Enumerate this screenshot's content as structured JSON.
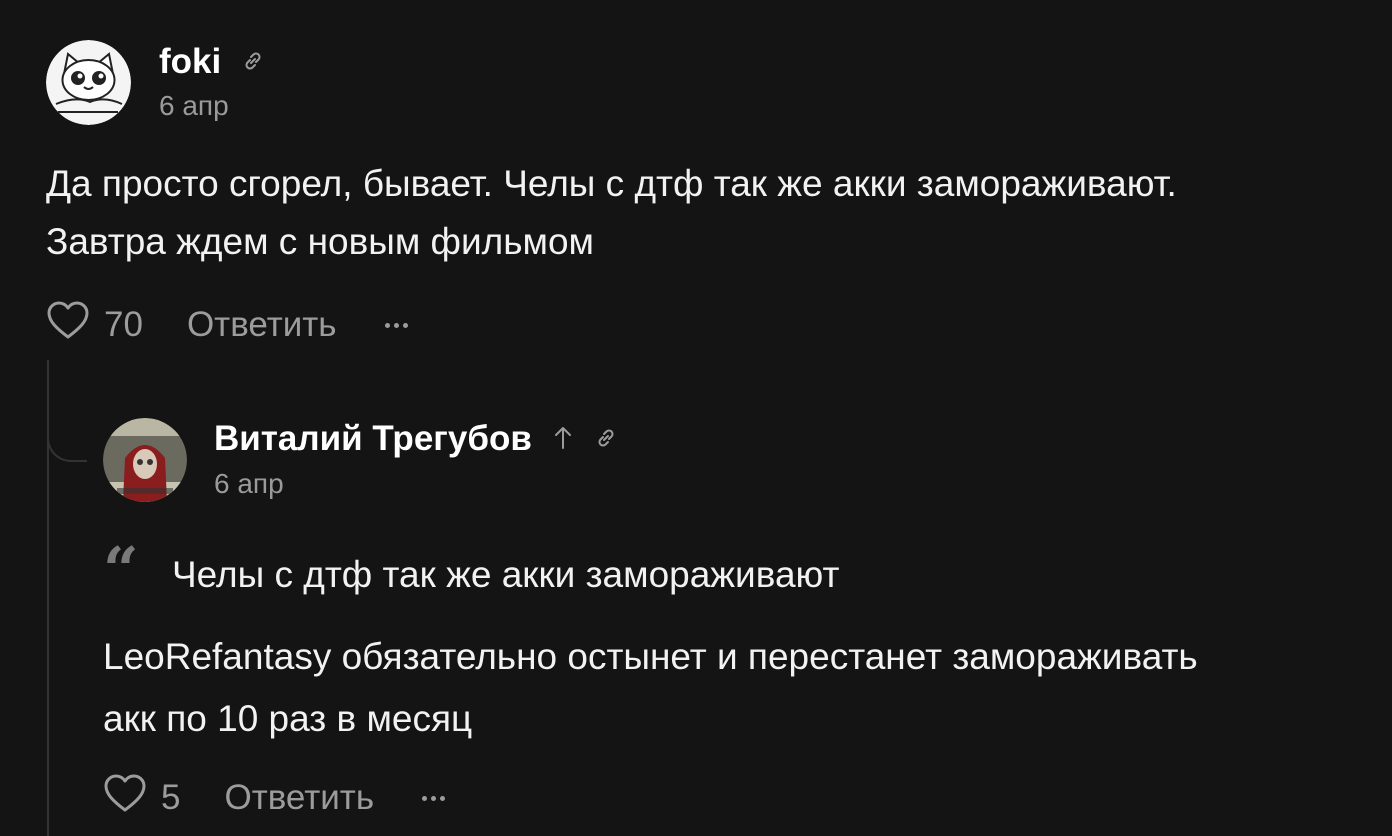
{
  "comment": {
    "author": "foki",
    "date": "6 апр",
    "text_line1": "Да просто сгорел, бывает. Челы с дтф так же акки замораживают.",
    "text_line2": "Завтра ждем с новым фильмом",
    "likes": "70",
    "reply_label": "Ответить",
    "avatar_icon": "cat-avatar",
    "link_icon": "link-icon"
  },
  "reply": {
    "author": "Виталий Трегубов",
    "date": "6 апр",
    "quote": "Челы с дтф так же акки замораживают",
    "text_line1": "LeoRefantasy обязательно остынет и перестанет замораживать",
    "text_line2": "акк по 10 раз в месяц",
    "likes": "5",
    "reply_label": "Ответить",
    "quote_icon": "quote-icon",
    "up_icon": "arrow-up-icon",
    "link_icon": "link-icon"
  },
  "colors": {
    "background": "#141414",
    "text": "#f2f2f2",
    "muted": "#9c9c9c",
    "thread_line": "#333333"
  }
}
